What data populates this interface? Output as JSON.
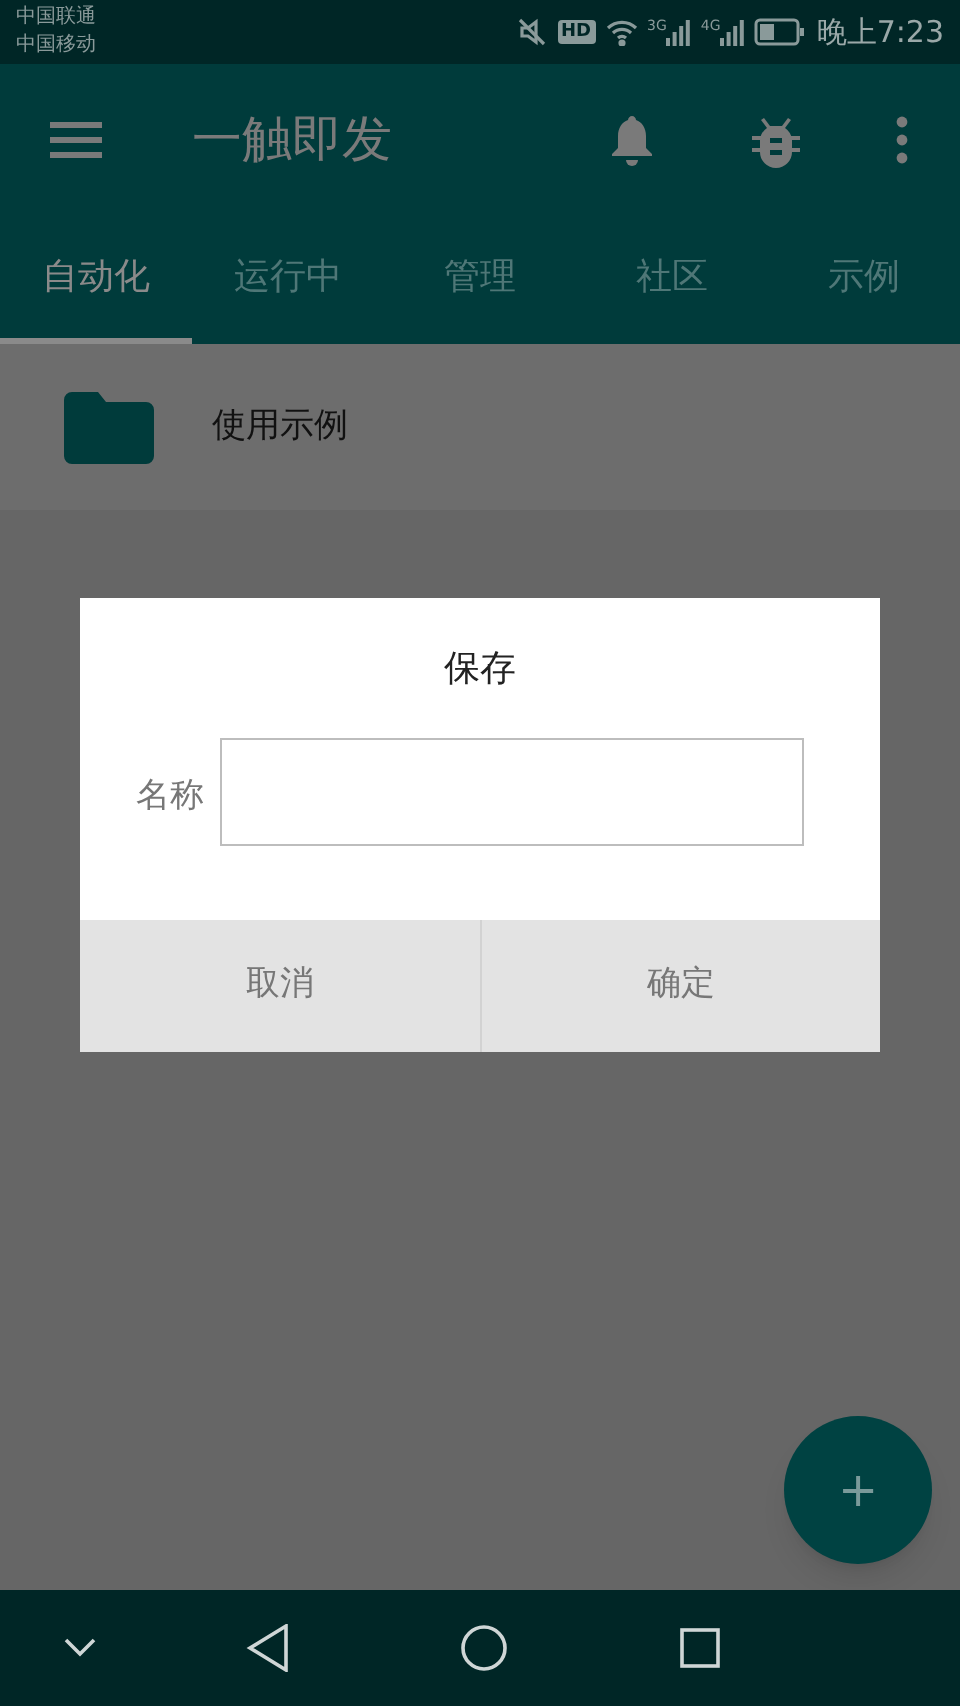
{
  "status_bar": {
    "carriers": [
      "中国联通",
      "中国移动"
    ],
    "hd_label": "HD",
    "networks": [
      "3G",
      "4G"
    ],
    "time": "晚上7:23"
  },
  "app_bar": {
    "title": "一触即发"
  },
  "tabs": [
    {
      "label": "自动化",
      "selected": true
    },
    {
      "label": "运行中",
      "selected": false
    },
    {
      "label": "管理",
      "selected": false
    },
    {
      "label": "社区",
      "selected": false
    },
    {
      "label": "示例",
      "selected": false
    }
  ],
  "list": [
    {
      "label": "使用示例"
    }
  ],
  "dialog": {
    "title": "保存",
    "field_label": "名称",
    "buttons": [
      "取消",
      "确定"
    ]
  },
  "fab": {
    "label": "+"
  }
}
